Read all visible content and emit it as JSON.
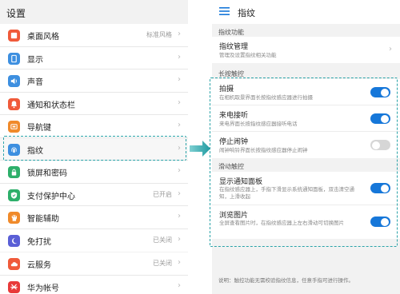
{
  "settings": {
    "title": "设置",
    "groups": [
      {
        "items": [
          {
            "label": "桌面风格",
            "value": "标准风格",
            "icon": "desktop-style-icon",
            "color": "#f05a3a"
          },
          {
            "label": "显示",
            "value": "",
            "icon": "display-icon",
            "color": "#3d8fe0"
          },
          {
            "label": "声音",
            "value": "",
            "icon": "sound-icon",
            "color": "#3d8fe0"
          },
          {
            "label": "通知和状态栏",
            "value": "",
            "icon": "notification-icon",
            "color": "#f05a3a"
          },
          {
            "label": "导航键",
            "value": "",
            "icon": "navigation-keys-icon",
            "color": "#f08a2a"
          },
          {
            "label": "指纹",
            "value": "",
            "icon": "fingerprint-icon",
            "color": "#3d8fe0"
          },
          {
            "label": "锁屏和密码",
            "value": "",
            "icon": "lock-icon",
            "color": "#2daf6a"
          },
          {
            "label": "支付保护中心",
            "value": "已开启",
            "icon": "payment-shield-icon",
            "color": "#2daf6a"
          },
          {
            "label": "智能辅助",
            "value": "",
            "icon": "smart-assist-icon",
            "color": "#f08a2a"
          },
          {
            "label": "免打扰",
            "value": "已关闭",
            "icon": "do-not-disturb-icon",
            "color": "#5a5fd6"
          }
        ]
      },
      {
        "items": [
          {
            "label": "云服务",
            "value": "已关闭",
            "icon": "cloud-icon",
            "color": "#f05a3a"
          },
          {
            "label": "华为帐号",
            "value": "",
            "icon": "huawei-account-icon",
            "color": "#e83a3a"
          }
        ]
      }
    ]
  },
  "fingerprint": {
    "title": "指纹",
    "sections": {
      "function": {
        "header": "指纹功能",
        "manage_title": "指纹管理",
        "manage_desc": "管理及设置指纹相关功能"
      },
      "long_press": {
        "header": "长按触控",
        "items": [
          {
            "title": "拍摄",
            "desc": "在相机取景界面长按指纹感应器进行拍摄",
            "on": true
          },
          {
            "title": "来电接听",
            "desc": "来电界面长按指纹感应器接听电话",
            "on": true
          },
          {
            "title": "停止闹钟",
            "desc": "闹钟响铃界面长按指纹感应器停止闹钟",
            "on": false
          }
        ]
      },
      "swipe": {
        "header": "滑动触控",
        "items": [
          {
            "title": "显示通知面板",
            "desc": "在指纹感应器上，手指下滑显示系统通知面板，双击清空通知，上滑收起",
            "on": true
          },
          {
            "title": "浏览图片",
            "desc": "全屏查看图片时，在指纹感应器上左右滑动可切换图片",
            "on": true
          }
        ]
      }
    },
    "note": "说明：触控功能无需校验指纹信息，任意手指可进行操作。"
  },
  "colors": {
    "accent": "#1677d9",
    "dash": "#2aa3a8",
    "toggle_off": "#d6d6d6"
  }
}
